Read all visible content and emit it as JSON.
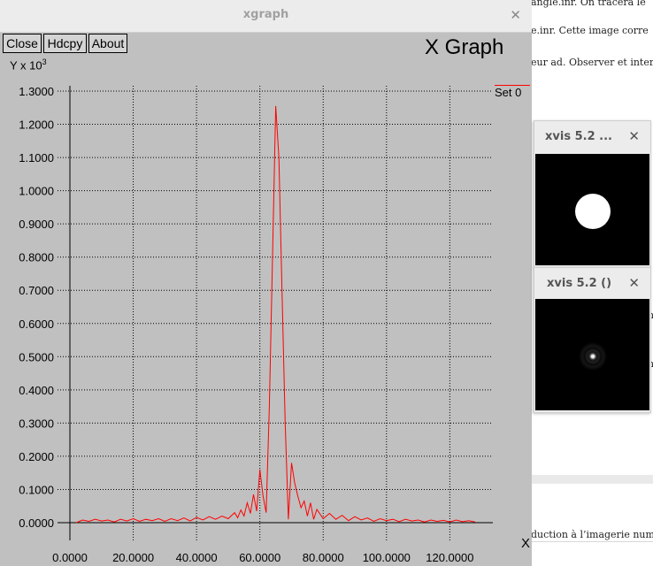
{
  "background_doc": {
    "lines": [
      "angle.inr. On tracera le",
      "e.inr. Cette image corre",
      "eur ad. Observer et inter",
      "n",
      ")",
      "n",
      "duction à l’imagerie num"
    ]
  },
  "xgraph": {
    "window_title": "xgraph",
    "buttons": {
      "close": "Close",
      "hdcpy": "Hdcpy",
      "about": "About"
    },
    "title": "X Graph",
    "ylabel_prefix": "Y x 10",
    "ylabel_exponent": "3",
    "legend": "Set 0",
    "corner_mark": "X",
    "colors": {
      "series": "#ff0000",
      "background": "#c0c0c0",
      "grid": "#000000"
    }
  },
  "xvis1": {
    "title": "xvis 5.2 ..."
  },
  "xvis2": {
    "title": "xvis 5.2 ()"
  },
  "chart_data": {
    "type": "line",
    "title": "X Graph",
    "ylabel": "Y x 10^3",
    "xlim": [
      0,
      128
    ],
    "ylim": [
      0,
      1.3
    ],
    "xticks": [
      "0.0000",
      "20.0000",
      "40.0000",
      "60.0000",
      "80.0000",
      "100.0000",
      "120.0000"
    ],
    "yticks": [
      "0.0000",
      "0.1000",
      "0.2000",
      "0.3000",
      "0.4000",
      "0.5000",
      "0.6000",
      "0.7000",
      "0.8000",
      "0.9000",
      "1.0000",
      "1.1000",
      "1.2000",
      "1.3000"
    ],
    "series": [
      {
        "name": "Set 0",
        "x": [
          2,
          4,
          6,
          8,
          10,
          12,
          14,
          16,
          18,
          20,
          22,
          24,
          26,
          28,
          30,
          32,
          34,
          36,
          38,
          40,
          42,
          44,
          46,
          48,
          50,
          52,
          53,
          54,
          55,
          56,
          57,
          58,
          59,
          60,
          61,
          62,
          63,
          64,
          65,
          66,
          67,
          68,
          69,
          70,
          71,
          72,
          73,
          74,
          75,
          76,
          77,
          78,
          80,
          82,
          84,
          86,
          88,
          90,
          92,
          94,
          96,
          98,
          100,
          102,
          104,
          106,
          108,
          110,
          112,
          114,
          116,
          118,
          120,
          122,
          124,
          126,
          128
        ],
        "values": [
          0.0,
          0.008,
          0.004,
          0.01,
          0.005,
          0.008,
          0.002,
          0.01,
          0.005,
          0.012,
          0.004,
          0.01,
          0.006,
          0.012,
          0.004,
          0.012,
          0.006,
          0.014,
          0.005,
          0.016,
          0.008,
          0.018,
          0.01,
          0.02,
          0.012,
          0.03,
          0.015,
          0.038,
          0.02,
          0.06,
          0.028,
          0.085,
          0.035,
          0.16,
          0.08,
          0.03,
          0.35,
          0.8,
          1.255,
          1.1,
          0.7,
          0.3,
          0.01,
          0.18,
          0.12,
          0.08,
          0.045,
          0.065,
          0.02,
          0.06,
          0.01,
          0.04,
          0.012,
          0.028,
          0.01,
          0.022,
          0.006,
          0.018,
          0.008,
          0.014,
          0.004,
          0.012,
          0.006,
          0.01,
          0.003,
          0.01,
          0.005,
          0.008,
          0.002,
          0.008,
          0.004,
          0.007,
          0.002,
          0.008,
          0.003,
          0.006,
          0.002
        ]
      }
    ]
  }
}
